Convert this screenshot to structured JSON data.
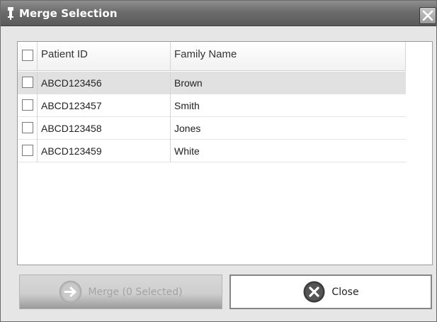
{
  "window": {
    "title": "Merge Selection",
    "title_icon": "pin-icon",
    "close_icon": "close-icon"
  },
  "grid": {
    "columns": [
      "Patient ID",
      "Family Name"
    ],
    "rows": [
      {
        "patient_id": "ABCD123456",
        "family_name": "Brown",
        "checked": false,
        "highlighted": true
      },
      {
        "patient_id": "ABCD123457",
        "family_name": "Smith",
        "checked": false,
        "highlighted": false
      },
      {
        "patient_id": "ABCD123458",
        "family_name": "Jones",
        "checked": false,
        "highlighted": false
      },
      {
        "patient_id": "ABCD123459",
        "family_name": "White",
        "checked": false,
        "highlighted": false
      }
    ],
    "select_all_checked": false
  },
  "buttons": {
    "merge": {
      "label": "Merge (0 Selected)",
      "icon": "arrow-right-circle-icon",
      "enabled": false
    },
    "close": {
      "label": "Close",
      "icon": "close-circle-icon",
      "enabled": true
    }
  },
  "colors": {
    "titlebar": "#6c6c6c",
    "row_highlight": "#e1e1e1",
    "disabled_text": "#a2a2a2"
  }
}
